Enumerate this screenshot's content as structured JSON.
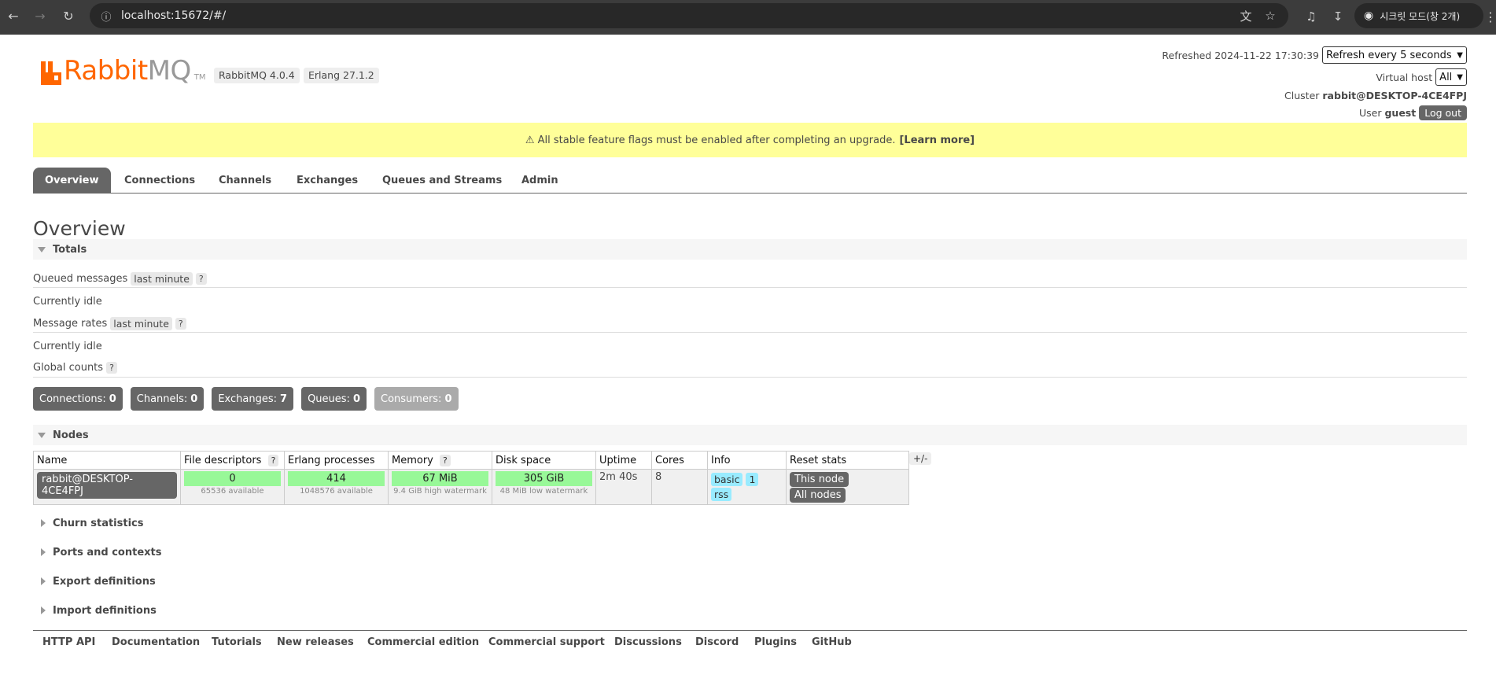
{
  "browser": {
    "url": "localhost:15672/#/",
    "incognito_label": "시크릿 모드(창 2개)",
    "icons": [
      "back-icon",
      "forward-icon",
      "reload-icon",
      "info-icon",
      "translate-icon",
      "star-icon",
      "media-icon",
      "download-icon",
      "incognito-icon",
      "menu-icon"
    ]
  },
  "header": {
    "logo_part1": "Rabbit",
    "logo_part2": "MQ",
    "logo_tm": "TM",
    "version": "RabbitMQ 4.0.4",
    "erlang": "Erlang 27.1.2",
    "refreshed_label": "Refreshed",
    "refreshed_time": "2024-11-22 17:30:39",
    "refresh_select": "Refresh every 5 seconds",
    "vhost_label": "Virtual host",
    "vhost_select": "All",
    "cluster_label": "Cluster",
    "cluster_name": "rabbit@DESKTOP-4CE4FPJ",
    "user_label": "User",
    "user_name": "guest",
    "logout": "Log out"
  },
  "banner": {
    "text": "⚠ All stable feature flags must be enabled after completing an upgrade.",
    "link": "[Learn more]",
    "color": "#ffff99"
  },
  "tabs": [
    "Overview",
    "Connections",
    "Channels",
    "Exchanges",
    "Queues and Streams",
    "Admin"
  ],
  "page_title": "Overview",
  "totals": {
    "title": "Totals",
    "queued_label": "Queued messages",
    "queued_range": "last minute",
    "help": "?",
    "idle1": "Currently idle",
    "rates_label": "Message rates",
    "rates_range": "last minute",
    "idle2": "Currently idle",
    "global_label": "Global counts",
    "counts": [
      {
        "label": "Connections:",
        "value": "0"
      },
      {
        "label": "Channels:",
        "value": "0"
      },
      {
        "label": "Exchanges:",
        "value": "7"
      },
      {
        "label": "Queues:",
        "value": "0"
      },
      {
        "label": "Consumers:",
        "value": "0"
      }
    ]
  },
  "nodes": {
    "title": "Nodes",
    "headers": [
      "Name",
      "File descriptors",
      "Erlang processes",
      "Memory",
      "Disk space",
      "Uptime",
      "Cores",
      "Info",
      "Reset stats"
    ],
    "row": {
      "name": "rabbit@DESKTOP-4CE4FPJ",
      "fd_value": "0",
      "fd_sub": "65536 available",
      "proc_value": "414",
      "proc_sub": "1048576 available",
      "mem_value": "67 MiB",
      "mem_sub": "9.4 GiB high watermark",
      "disk_value": "305 GiB",
      "disk_sub": "48 MiB low watermark",
      "uptime": "2m 40s",
      "cores": "8",
      "info_tags": [
        "basic",
        "1",
        "rss"
      ],
      "reset_this": "This node",
      "reset_all": "All nodes"
    },
    "columns_toggle": "+/-",
    "ok_color": "#98f898"
  },
  "sections": [
    "Churn statistics",
    "Ports and contexts",
    "Export definitions",
    "Import definitions"
  ],
  "footer": [
    "HTTP API",
    "Documentation",
    "Tutorials",
    "New releases",
    "Commercial edition",
    "Commercial support",
    "Discussions",
    "Discord",
    "Plugins",
    "GitHub"
  ],
  "colors": {
    "brand": "#ff6600",
    "dark_button": "#666666",
    "info_tag": "#99ebff"
  }
}
